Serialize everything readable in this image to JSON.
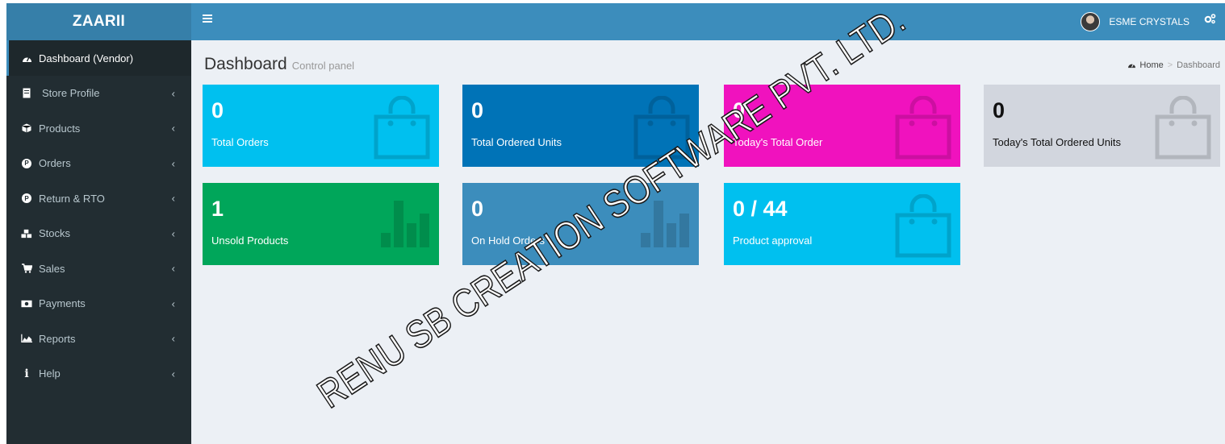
{
  "brand": {
    "logo": "ZAARII"
  },
  "header": {
    "user_name": "ESME CRYSTALS"
  },
  "sidebar": {
    "items": [
      {
        "label": "Dashboard (Vendor)",
        "icon": "dashboard-icon",
        "active": true
      },
      {
        "label": "Store Profile",
        "icon": "store-icon"
      },
      {
        "label": "Products",
        "icon": "cube-icon"
      },
      {
        "label": "Orders",
        "icon": "p-circle-icon"
      },
      {
        "label": "Return & RTO",
        "icon": "p-circle-icon"
      },
      {
        "label": "Stocks",
        "icon": "cubes-icon"
      },
      {
        "label": "Sales",
        "icon": "cart-icon"
      },
      {
        "label": "Payments",
        "icon": "money-icon"
      },
      {
        "label": "Reports",
        "icon": "area-chart-icon"
      },
      {
        "label": "Help",
        "icon": "info-icon"
      }
    ]
  },
  "page": {
    "title": "Dashboard",
    "subtitle": "Control panel",
    "breadcrumb": {
      "home": "Home",
      "current": "Dashboard",
      "separator": ">"
    }
  },
  "stats": [
    {
      "value": "0",
      "label": "Total Orders",
      "color": "#00c0ef",
      "icon": "shopping-bag-icon"
    },
    {
      "value": "0",
      "label": "Total Ordered Units",
      "color": "#0073b7",
      "icon": "shopping-bag-icon"
    },
    {
      "value": "0",
      "label": "Today's Total Order",
      "color": "#f012be",
      "icon": "shopping-bag-icon"
    },
    {
      "value": "0",
      "label": "Today's Total Ordered Units",
      "color": "#d2d6de",
      "icon": "shopping-bag-icon"
    },
    {
      "value": "1",
      "label": "Unsold Products",
      "color": "#00a65a",
      "icon": "bar-chart-icon"
    },
    {
      "value": "0",
      "label": "On Hold Orders",
      "color": "#3c8dbc",
      "icon": "bar-chart-icon"
    },
    {
      "value": "0 / 44",
      "label": "Product approval",
      "color": "#00c0ef",
      "icon": "shopping-bag-icon"
    }
  ],
  "watermark": {
    "text": "RENU SB CREATION SOFTWARE PVT. LTD."
  }
}
